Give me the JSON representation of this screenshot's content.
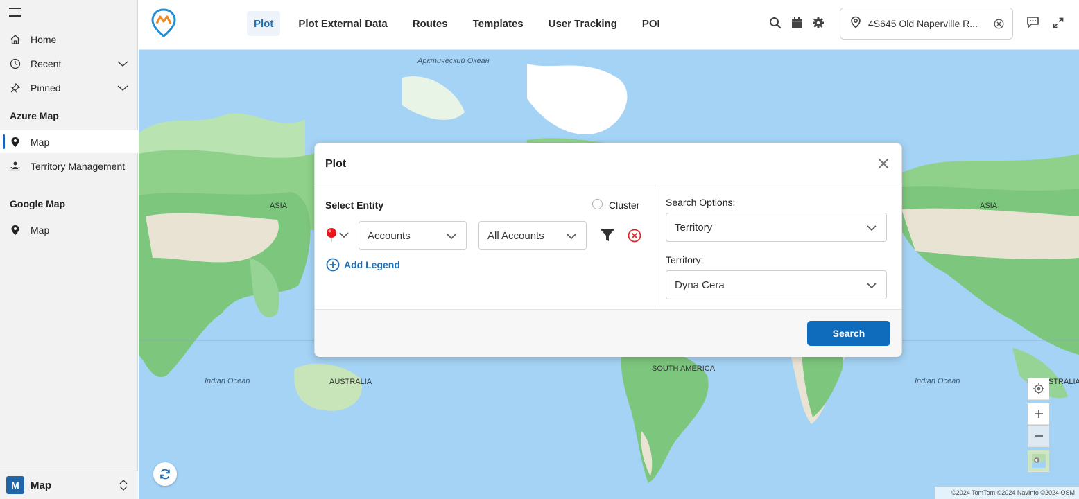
{
  "sidebar": {
    "items": [
      {
        "label": "Home",
        "icon": "home-icon"
      },
      {
        "label": "Recent",
        "icon": "clock-icon"
      },
      {
        "label": "Pinned",
        "icon": "pin-icon"
      }
    ],
    "sections": [
      {
        "title": "Azure Map",
        "items": [
          {
            "label": "Map",
            "icon": "map-marker-icon"
          },
          {
            "label": "Territory Management",
            "icon": "territory-icon"
          }
        ]
      },
      {
        "title": "Google Map",
        "items": [
          {
            "label": "Map",
            "icon": "map-marker-icon"
          }
        ]
      }
    ],
    "footer": {
      "badge": "M",
      "label": "Map"
    }
  },
  "topbar": {
    "tabs": [
      "Plot",
      "Plot External Data",
      "Routes",
      "Templates",
      "User Tracking",
      "POI"
    ],
    "active_tab": "Plot",
    "address": "4S645 Old Naperville R...",
    "accent_color": "#1f6fb5"
  },
  "map": {
    "labels": {
      "arctic": "Арктический Океан",
      "asia_left": "ASIA",
      "asia_right": "ASIA",
      "indian_left": "Indian Ocean",
      "indian_right": "Indian Ocean",
      "australia": "AUSTRALIA",
      "south_america": "SOUTH AMERICA",
      "australia_right": "STRALIA"
    },
    "attribution": "©2024 TomTom ©2024 NavInfo ©2024 OSM"
  },
  "modal": {
    "title": "Plot",
    "select_entity_label": "Select Entity",
    "cluster_label": "Cluster",
    "entity_value": "Accounts",
    "view_value": "All Accounts",
    "add_legend_label": "Add Legend",
    "search_options_label": "Search Options:",
    "search_options_value": "Territory",
    "territory_label": "Territory:",
    "territory_value": "Dyna Cera",
    "search_button": "Search"
  }
}
